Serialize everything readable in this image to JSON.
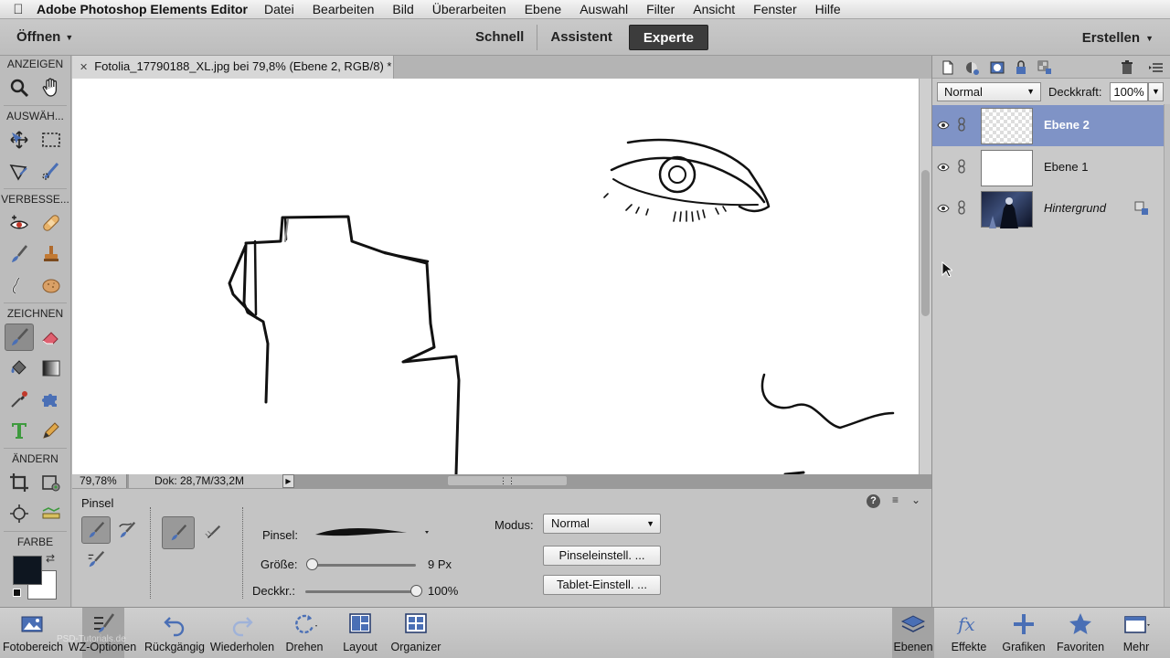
{
  "menubar": {
    "app_name": "Adobe Photoshop Elements Editor",
    "items": [
      "Datei",
      "Bearbeiten",
      "Bild",
      "Überarbeiten",
      "Ebene",
      "Auswahl",
      "Filter",
      "Ansicht",
      "Fenster",
      "Hilfe"
    ]
  },
  "modebar": {
    "open_label": "Öffnen",
    "modes": [
      "Schnell",
      "Assistent",
      "Experte"
    ],
    "active_mode": "Experte",
    "create_label": "Erstellen"
  },
  "tools": {
    "sections": {
      "view": "ANZEIGEN",
      "select": "AUSWÄH...",
      "enhance": "VERBESSE...",
      "draw": "ZEICHNEN",
      "modify": "ÄNDERN",
      "color": "FARBE"
    },
    "foreground_color": "#0e1620",
    "background_color": "#ffffff",
    "active_tool": "brush"
  },
  "document": {
    "tab_title": "Fotolia_17790188_XL.jpg bei 79,8% (Ebene 2, RGB/8) *",
    "zoom": "79,78%",
    "doc_size": "Dok: 28,7M/33,2M"
  },
  "options": {
    "tool_name": "Pinsel",
    "brush_label": "Pinsel:",
    "size_label": "Größe:",
    "size_value": "9 Px",
    "size_fraction": 0.0,
    "opacity_label": "Deckkr.:",
    "opacity_value": "100%",
    "opacity_fraction": 1.0,
    "mode_label": "Modus:",
    "mode_value": "Normal",
    "brush_settings_button": "Pinseleinstell. ...",
    "tablet_settings_button": "Tablet-Einstell. ..."
  },
  "layers": {
    "blend_mode": "Normal",
    "opacity_label": "Deckkraft:",
    "opacity_value": "100%",
    "items": [
      {
        "name": "Ebene 2",
        "selected": true,
        "thumb": "transparent"
      },
      {
        "name": "Ebene 1",
        "selected": false,
        "thumb": "white"
      },
      {
        "name": "Hintergrund",
        "selected": false,
        "thumb": "photo",
        "locked": true
      }
    ]
  },
  "bottombar": {
    "left": [
      "Fotobereich",
      "WZ-Optionen",
      "Rückgängig",
      "Wiederholen",
      "Drehen",
      "Layout",
      "Organizer"
    ],
    "right": [
      "Ebenen",
      "Effekte",
      "Grafiken",
      "Favoriten",
      "Mehr"
    ],
    "watermark": "PSD-Tutorials.de"
  },
  "colors": {
    "accent_selected_layer": "#7f93c6",
    "active_mode_bg": "#3c3c3c"
  }
}
